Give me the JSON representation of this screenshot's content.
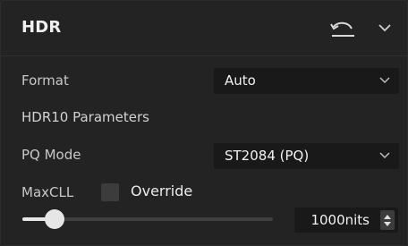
{
  "panel": {
    "title": "HDR",
    "icons": {
      "reset": "undo-reset-icon",
      "collapse": "chevron-down-icon"
    }
  },
  "format": {
    "label": "Format",
    "value": "Auto"
  },
  "section": {
    "label": "HDR10 Parameters"
  },
  "pq_mode": {
    "label": "PQ Mode",
    "value": "ST2084 (PQ)"
  },
  "maxcll": {
    "label": "MaxCLL",
    "override_label": "Override",
    "override_checked": false,
    "value": "1000nits",
    "slider_level": 0.13
  },
  "colors": {
    "panel_bg": "#232323",
    "field_bg": "#191919",
    "accent": "#e6e6e6",
    "text": "#c8c8c8"
  }
}
